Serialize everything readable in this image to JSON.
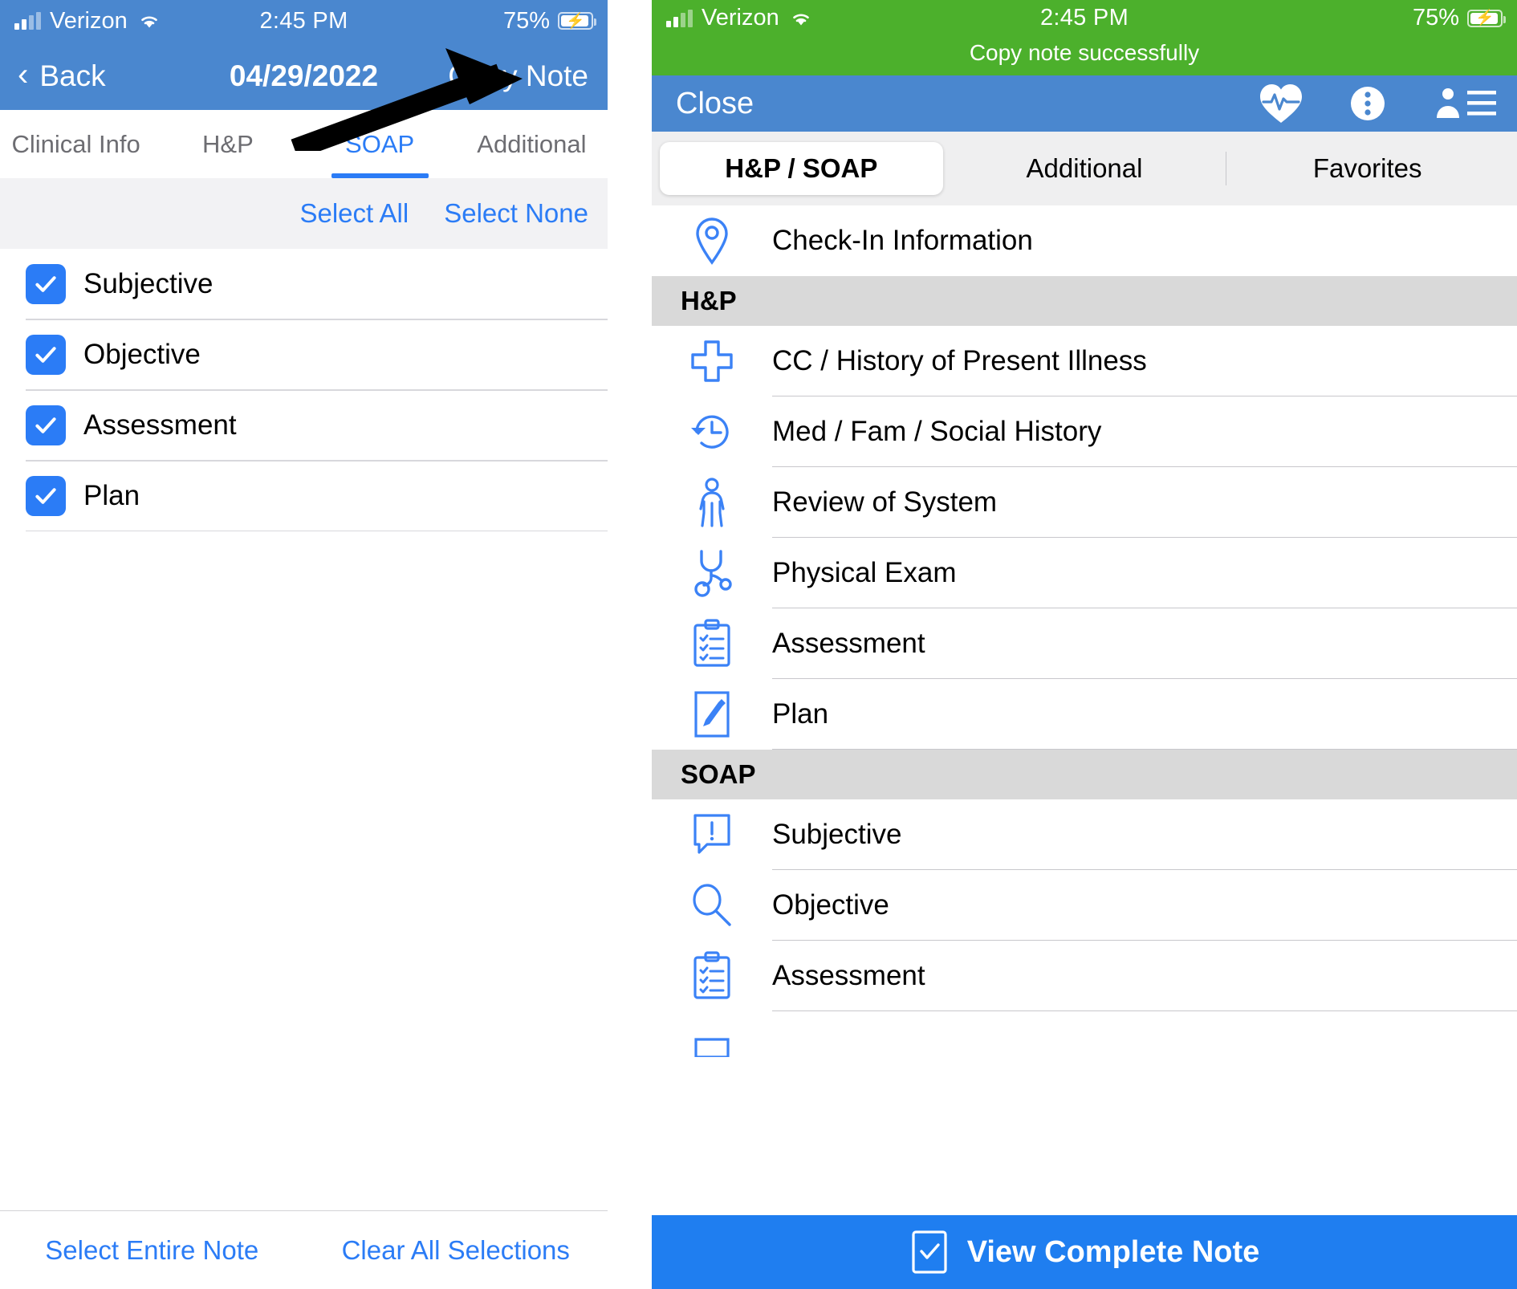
{
  "left": {
    "status": {
      "carrier": "Verizon",
      "time": "2:45 PM",
      "battery": "75%"
    },
    "nav": {
      "back": "Back",
      "back_icon": "chevron-left-icon",
      "date": "04/29/2022",
      "copy": "Copy Note"
    },
    "tabs": [
      {
        "label": "Clinical Info",
        "active": false
      },
      {
        "label": "H&P",
        "active": false
      },
      {
        "label": "SOAP",
        "active": true
      },
      {
        "label": "Additional",
        "active": false
      }
    ],
    "selection_bar": {
      "select_all": "Select All",
      "select_none": "Select None"
    },
    "items": [
      {
        "label": "Subjective",
        "checked": true
      },
      {
        "label": "Objective",
        "checked": true
      },
      {
        "label": "Assessment",
        "checked": true
      },
      {
        "label": "Plan",
        "checked": true
      }
    ],
    "bottom": {
      "entire": "Select Entire Note",
      "clear": "Clear All Selections"
    },
    "annotation": {
      "type": "arrow",
      "points_to": "Copy Note"
    }
  },
  "right": {
    "status": {
      "carrier": "Verizon",
      "time": "2:45 PM",
      "battery": "75%",
      "toast": "Copy note successfully"
    },
    "nav": {
      "close": "Close",
      "icons": [
        "heart-pulse-icon",
        "more-vertical-icon",
        "patient-list-icon"
      ]
    },
    "segments": [
      {
        "label": "H&P / SOAP",
        "active": true
      },
      {
        "label": "Additional",
        "active": false
      },
      {
        "label": "Favorites",
        "active": false
      }
    ],
    "top_rows": [
      {
        "label": "Check-In Information",
        "icon": "location-pin-icon"
      }
    ],
    "sections": [
      {
        "header": "H&P",
        "rows": [
          {
            "label": "CC / History of Present Illness",
            "icon": "medical-cross-icon"
          },
          {
            "label": "Med / Fam / Social History",
            "icon": "history-clock-icon"
          },
          {
            "label": "Review of System",
            "icon": "person-icon"
          },
          {
            "label": "Physical Exam",
            "icon": "stethoscope-icon"
          },
          {
            "label": "Assessment",
            "icon": "clipboard-checklist-icon"
          },
          {
            "label": "Plan",
            "icon": "pen-note-icon"
          }
        ]
      },
      {
        "header": "SOAP",
        "rows": [
          {
            "label": "Subjective",
            "icon": "speech-bubble-alert-icon"
          },
          {
            "label": "Objective",
            "icon": "magnifier-icon"
          },
          {
            "label": "Assessment",
            "icon": "clipboard-checklist-icon"
          }
        ]
      }
    ],
    "bottom_button": {
      "label": "View Complete Note",
      "icon": "document-check-icon"
    }
  },
  "colors": {
    "nav_blue": "#4a87cf",
    "accent_blue": "#2b7cf6",
    "toast_green": "#4cb02c",
    "section_grey": "#d9d9d9",
    "cta_blue": "#1f7ef0"
  }
}
